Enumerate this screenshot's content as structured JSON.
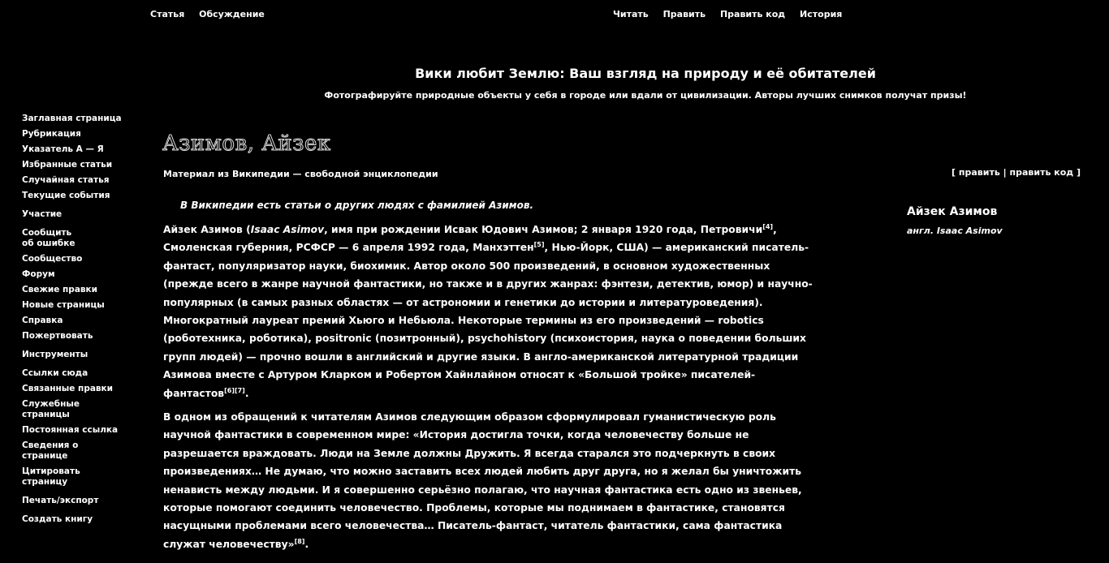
{
  "top_nav": {
    "left": [
      "Статья",
      "Обсуждение"
    ],
    "right": [
      "Читать",
      "Править",
      "Править код",
      "История"
    ]
  },
  "banner": {
    "title": "Вики любит Землю: Ваш взгляд на природу и её обитателей",
    "subtitle": "Фотографируйте природные объекты у себя в городе или вдали от цивилизации. Авторы лучших снимков получат призы!"
  },
  "sidebar": {
    "main": [
      "Заглавная страница",
      "Рубрикация",
      "Указатель А — Я",
      "Избранные статьи",
      "Случайная статья",
      "Текущие события"
    ],
    "participation_title": "Участие",
    "participation": [
      "Сообщить об ошибке",
      "Сообщество",
      "Форум",
      "Свежие правки",
      "Новые страницы",
      "Справка",
      "Пожертвовать"
    ],
    "tools_title": "Инструменты",
    "tools": [
      "Ссылки сюда",
      "Связанные правки",
      "Служебные страницы",
      "Постоянная ссылка",
      "Сведения о странице",
      "Цитировать страницу"
    ],
    "print_title": "Печать/экспорт",
    "print": [
      "Создать книгу"
    ]
  },
  "article": {
    "title": "Азимов, Айзек",
    "tagline": "Материал из Википедии — свободной энциклопедии",
    "edit_open": "[ ",
    "edit_label": "править",
    "edit_sep": " | ",
    "edit_code_label": "править код",
    "edit_close": " ]",
    "hatnote": "В Википедии есть статьи о других людях с фамилией Азимов.",
    "p1": {
      "name": "Айзек Азимов",
      "s1": " (",
      "latin": "Isaac Asimov",
      "s2": ", имя при рождении ",
      "birth_name": "Исвак Юдович Азимов",
      "s3": "; 2 января 1920 года, Петровичи",
      "ref1": "[4]",
      "s4": ", Смоленская губерния, РСФСР — 6 апреля 1992 года, Манхэттен",
      "ref2": "[5]",
      "s5": ", Нью-Йорк, США) — американский писатель-фантаст, популяризатор науки, биохимик. Автор около 500 произведений, в основном художественных (прежде всего в жанре научной фантастики, но также и в других жанрах: фэнтези, детектив, юмор) и научно-популярных (в самых разных областях — от астрономии и генетики до истории и литературоведения). Многократный лауреат премий Хьюго и Небьюла. Некоторые термины из его произведений — robotics (роботехника, роботика), positronic (позитронный), psychohistory (психоистория, наука о поведении больших групп людей) — прочно вошли в английский и другие языки. В англо-американской литературной традиции Азимова вместе с Артуром Кларком и Робертом Хайнлайном относят к «Большой тройке» писателей-фантастов",
      "ref3": "[6][7]",
      "s6": "."
    },
    "p2": {
      "text": "В одном из обращений к читателям Азимов следующим образом сформулировал гуманистическую роль научной фантастики в современном мире: «История достигла точки, когда человечеству больше не разрешается враждовать. Люди на Земле должны Дружить. Я всегда старался это подчеркнуть в своих произведениях… Не думаю, что можно заставить всех людей любить друг друга, но я желал бы уничтожить ненависть между людьми. И я совершенно серьёзно полагаю, что научная фантастика есть одно из звеньев, которые помогают соединить человечество. Проблемы, которые мы поднимаем в фантастике, становятся насущными проблемами всего человечества… Писатель-фантаст, читатель фантастики, сама фантастика служат человечеству»",
      "ref": "[8]",
      "end": "."
    }
  },
  "infobox": {
    "name": "Айзек Азимов",
    "original": "англ. Isaac Asimov"
  }
}
